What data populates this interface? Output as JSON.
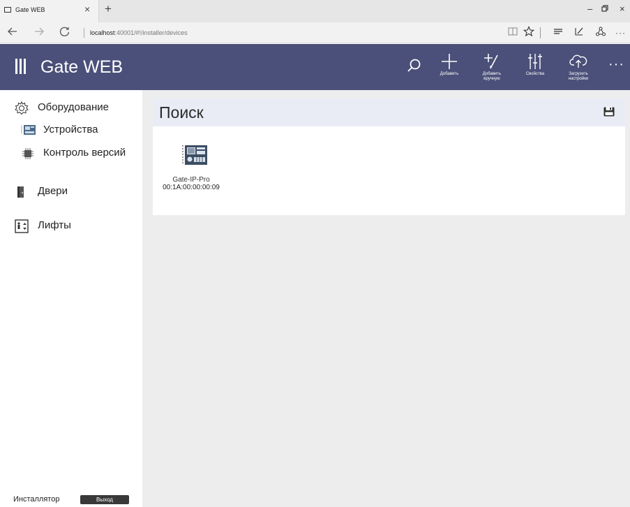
{
  "browser": {
    "tab_title": "Gate WEB",
    "tab_close": "×",
    "new_tab": "+",
    "url_host": "localhost",
    "url_path": ":40001/#!/installer/devices",
    "window_controls": [
      "–",
      "▫",
      "×"
    ],
    "nav_icons": [
      "back-arrow-icon",
      "forward-arrow-icon",
      "refresh-icon"
    ],
    "toolbar_icons": [
      "reading-view-icon",
      "favorites-star-icon",
      "hub-icon",
      "web-note-icon",
      "share-icon",
      "more-icon"
    ]
  },
  "header": {
    "title": "Gate WEB",
    "buttons": {
      "add": "Добавить",
      "add_manual_line1": "Добавить",
      "add_manual_line2": "вручную",
      "properties": "Свойства",
      "upload_line1": "Загрузить",
      "upload_line2": "настройки"
    },
    "more": "···",
    "bg_color": "#4a5079"
  },
  "sidebar": {
    "items": [
      {
        "label": "Оборудование"
      },
      {
        "label": "Устройства"
      },
      {
        "label": "Контроль версий"
      },
      {
        "label": "Двери"
      },
      {
        "label": "Лифты"
      }
    ],
    "user": "Инсталлятор",
    "logout": "Выход"
  },
  "main": {
    "title": "Поиск",
    "devices": [
      {
        "name": "Gate-IP-Pro",
        "mac": "00:1A:00:00:00:09"
      }
    ]
  }
}
